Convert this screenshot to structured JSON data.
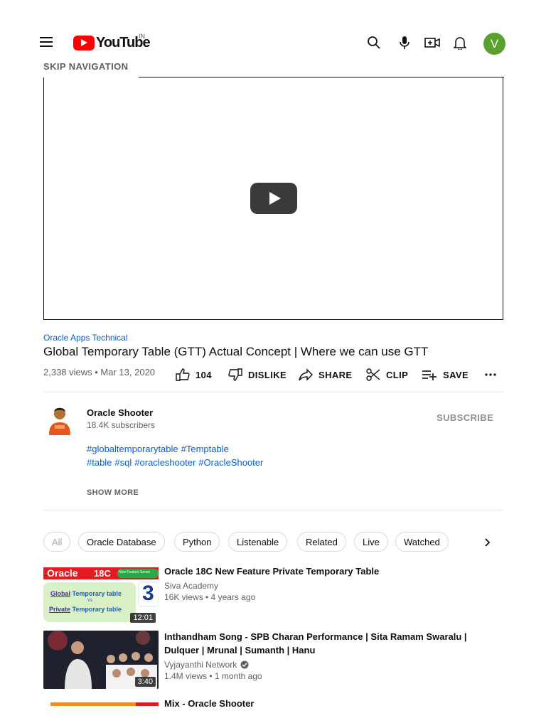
{
  "header": {
    "logo_text": "YouTube",
    "country_code": "IN",
    "avatar_letter": "V",
    "icons": [
      "menu-icon",
      "search-icon",
      "mic-icon",
      "create-icon",
      "bell-icon"
    ],
    "skip_navigation": "SKIP NAVIGATION"
  },
  "video": {
    "channel_tag": "Oracle Apps Technical",
    "title": "Global Temporary Table (GTT) Actual Concept | Where we can use GTT",
    "views_date": "2,338 views • Mar 13, 2020",
    "actions": {
      "like_count": "104",
      "dislike": "DISLIKE",
      "share": "SHARE",
      "clip": "CLIP",
      "save": "SAVE"
    }
  },
  "channel": {
    "name": "Oracle Shooter",
    "subscribers": "18.4K subscribers",
    "subscribe_label": "SUBSCRIBE",
    "description_line1": [
      "#globaltemporarytable",
      "#Temptable"
    ],
    "description_line2": [
      "#table",
      "#sql",
      "#oracleshooter",
      "#OracleShooter"
    ],
    "show_more": "SHOW MORE"
  },
  "chips": [
    "All",
    "Oracle Database",
    "Python",
    "Listenable",
    "Related",
    "Live",
    "Watched"
  ],
  "recommendations": [
    {
      "title": "Oracle 18C New Feature Private Temporary Table",
      "channel": "Siva Academy",
      "stats": "16K views • 4 years ago",
      "duration": "12:01",
      "thumb_text": {
        "oracle": "Oracle",
        "version": "18C",
        "series": "New Feature Series",
        "global": "Global",
        "temp1": "Temporary table",
        "vs": "Vs",
        "private": "Private",
        "temp2": "Temporary table",
        "number": "3"
      }
    },
    {
      "title": "Inthandham Song - SPB Charan Performance | Sita Ramam Swaralu | Dulquer | Mrunal | Sumanth | Hanu",
      "channel": "Vyjayanthi Network",
      "stats": "1.4M views • 1 month ago",
      "duration": "3:40"
    },
    {
      "title": "Mix - Oracle Shooter"
    }
  ]
}
